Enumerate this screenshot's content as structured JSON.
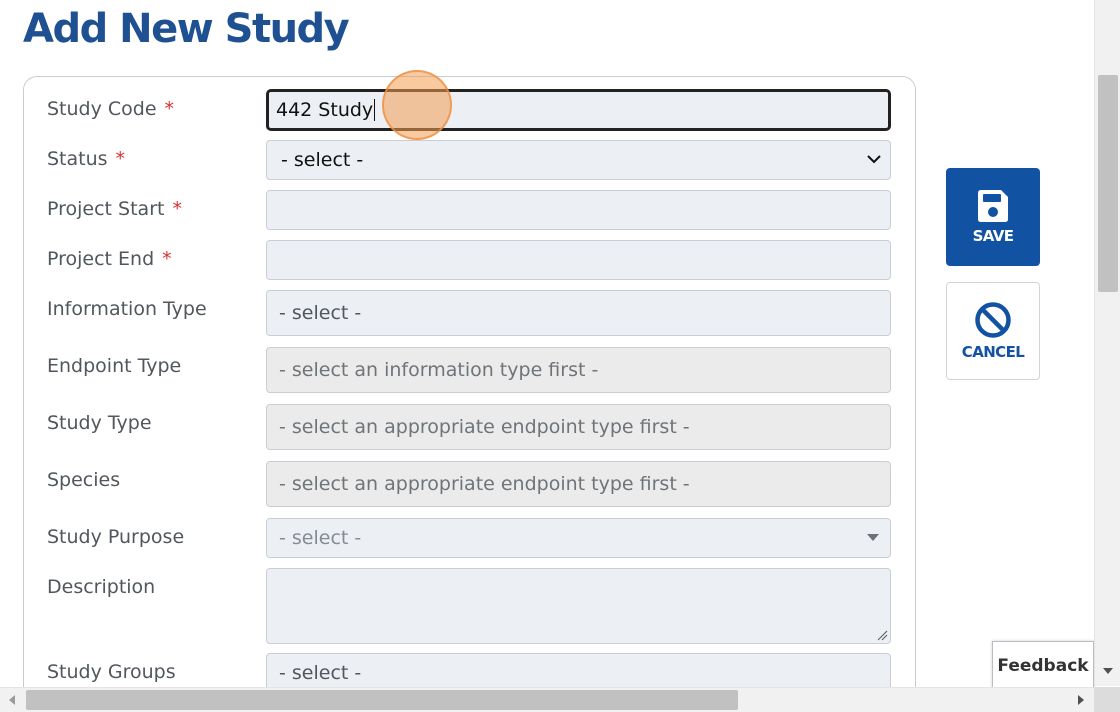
{
  "page": {
    "title": "Add New Study"
  },
  "form": {
    "fields": [
      {
        "label": "Study Code",
        "required": "*",
        "value": "442 Study"
      },
      {
        "label": "Status",
        "required": "*",
        "value": "- select -"
      },
      {
        "label": "Project Start",
        "required": "*",
        "value": ""
      },
      {
        "label": "Project End",
        "required": "*",
        "value": ""
      },
      {
        "label": "Information Type",
        "value": "- select -"
      },
      {
        "label": "Endpoint Type",
        "value": "- select an information type first -"
      },
      {
        "label": "Study Type",
        "value": "- select an appropriate endpoint type first -"
      },
      {
        "label": "Species",
        "value": "- select an appropriate endpoint type first -"
      },
      {
        "label": "Study Purpose",
        "value": "- select -"
      },
      {
        "label": "Description",
        "value": ""
      },
      {
        "label": "Study Groups",
        "value": "- select -"
      }
    ]
  },
  "actions": {
    "save_label": "SAVE",
    "save_icon": "floppy-disk-icon",
    "cancel_label": "CANCEL",
    "cancel_icon": "no-entry-icon"
  },
  "feedback": {
    "label": "Feedback"
  },
  "colors": {
    "title": "#1f5192",
    "primary": "#1252a3",
    "required": "#d9302f"
  }
}
